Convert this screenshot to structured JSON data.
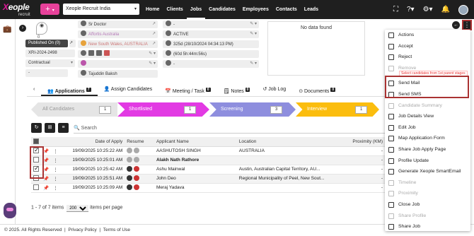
{
  "app": {
    "logo": "Xeople",
    "logo_sub": "recruit",
    "company": "Xeople Recruit India"
  },
  "nav": [
    "Home",
    "Clients",
    "Jobs",
    "Candidates",
    "Employees",
    "Contacts",
    "Leads"
  ],
  "job": {
    "contact": "Sr Doctor",
    "client": "Affortis Australia",
    "location": "New South Wales, AUSTRALIA",
    "owner": "Tajuddin Baksh",
    "published": "Published On (0)",
    "ref": "XRI-2024-2498",
    "type": "Contractual",
    "status": "ACTIVE",
    "created": "325d (28/10/2024 04:34:13 PM)",
    "hours": "(60d 5h:44m:56s)",
    "dash": "-",
    "no_data": "No data found"
  },
  "tabs": [
    {
      "label": "Applications",
      "count": "7"
    },
    {
      "label": "Assign Candidates",
      "count": ""
    },
    {
      "label": "Meeting / Task",
      "count": "0"
    },
    {
      "label": "Notes",
      "count": "0"
    },
    {
      "label": "Job Log",
      "count": ""
    },
    {
      "label": "Documents",
      "count": "0"
    }
  ],
  "stages": [
    {
      "label": "All Candidates",
      "count": "1"
    },
    {
      "label": "Shortlisted",
      "count": "1"
    },
    {
      "label": "Screening",
      "count": "3"
    },
    {
      "label": "Interview",
      "count": "1"
    }
  ],
  "search_placeholder": "Search",
  "table": {
    "headers": [
      "Date of Apply",
      "Resume",
      "Applicant Name",
      "Location",
      "Proximity (KM)"
    ],
    "rows": [
      {
        "date": "19/09/2025 10:25:22 AM",
        "name": "AASHUTOSH SINGH",
        "loc": "AUSTRALIA",
        "prox": "-",
        "checked": true
      },
      {
        "date": "19/09/2025 10:25:01 AM",
        "name": "Alakh Nath Rathore",
        "loc": "",
        "prox": "-",
        "checked": false
      },
      {
        "date": "19/09/2025 10:25:42 AM",
        "name": "Ashu Mainwal",
        "loc": "Austin, Australian Capital Territory, AU...",
        "prox": "-",
        "checked": true
      },
      {
        "date": "19/09/2025 10:25:51 AM",
        "name": "John Deo",
        "loc": "Regional Municipality of Peel, New Sout...",
        "prox": "-",
        "checked": false
      },
      {
        "date": "19/09/2025 10:25:09 AM",
        "name": "Meraj Yadava",
        "loc": "",
        "prox": "-",
        "checked": false
      }
    ]
  },
  "pager": {
    "range": "1 - 7 of 7 items",
    "per_page": "200",
    "per_page_label": "items per page"
  },
  "footer": {
    "copy": "© 2025. All Rights Reserved",
    "privacy": "Privacy Policy",
    "terms": "Terms of Use"
  },
  "menu": [
    {
      "label": "Actions",
      "disabled": false
    },
    {
      "label": "Accept",
      "disabled": false
    },
    {
      "label": "Reject",
      "disabled": false
    },
    {
      "label": "Remove",
      "disabled": true
    },
    {
      "label": "Send Mail",
      "disabled": false
    },
    {
      "label": "Send SMS",
      "disabled": false
    },
    {
      "label": "Candidate Summary",
      "disabled": true
    },
    {
      "label": "Job Details View",
      "disabled": false
    },
    {
      "label": "Edit Job",
      "disabled": false
    },
    {
      "label": "Map Application Form",
      "disabled": false
    },
    {
      "label": "Share Job Apply Page",
      "disabled": false
    },
    {
      "label": "Profile Update",
      "disabled": false
    },
    {
      "label": "Generate Xeople SmartEmail",
      "disabled": false
    },
    {
      "label": "Timeline",
      "disabled": true
    },
    {
      "label": "Proximity",
      "disabled": true
    },
    {
      "label": "Close Job",
      "disabled": false
    },
    {
      "label": "Share Profile",
      "disabled": true
    },
    {
      "label": "Share Job",
      "disabled": false
    }
  ],
  "menu_tip": "Select candidates from 1st parent stages"
}
